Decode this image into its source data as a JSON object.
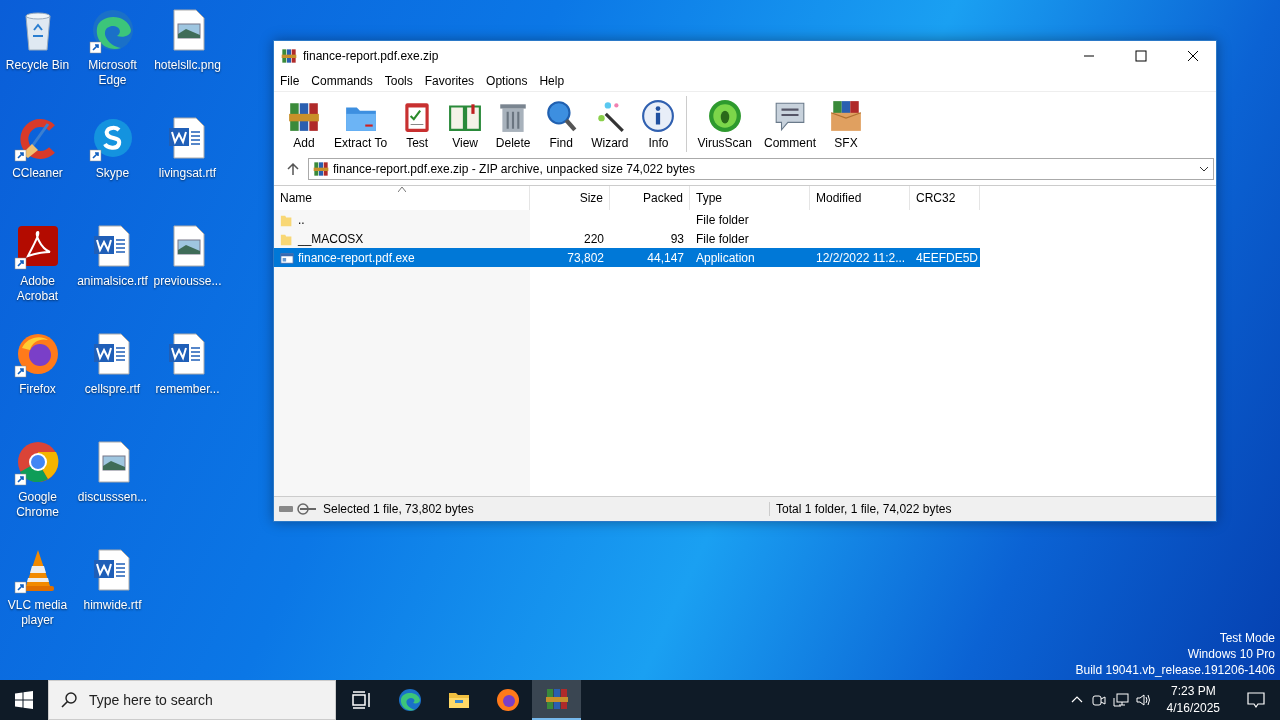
{
  "desktop": {
    "icons": [
      {
        "label": "Recycle Bin",
        "kind": "recycle",
        "shortcut": false
      },
      {
        "label": "CCleaner",
        "kind": "ccleaner",
        "shortcut": true
      },
      {
        "label": "Adobe Acrobat",
        "kind": "pdf",
        "shortcut": true
      },
      {
        "label": "Firefox",
        "kind": "firefox",
        "shortcut": true
      },
      {
        "label": "Google Chrome",
        "kind": "chrome",
        "shortcut": true
      },
      {
        "label": "VLC media player",
        "kind": "vlc",
        "shortcut": true
      },
      {
        "label": "Microsoft Edge",
        "kind": "edge",
        "shortcut": true
      },
      {
        "label": "Skype",
        "kind": "skype",
        "shortcut": true
      },
      {
        "label": "animalsice.rtf",
        "kind": "word",
        "shortcut": false
      },
      {
        "label": "cellspre.rtf",
        "kind": "word",
        "shortcut": false
      },
      {
        "label": "discusssen...",
        "kind": "image",
        "shortcut": false
      },
      {
        "label": "himwide.rtf",
        "kind": "word",
        "shortcut": false
      },
      {
        "label": "hotelsllc.png",
        "kind": "image",
        "shortcut": false
      },
      {
        "label": "livingsat.rtf",
        "kind": "word",
        "shortcut": false
      },
      {
        "label": "previousse...",
        "kind": "image",
        "shortcut": false
      },
      {
        "label": "remember...",
        "kind": "word",
        "shortcut": false
      }
    ],
    "system_text": [
      "Test Mode",
      "Windows 10 Pro",
      "Build 19041.vb_release.191206-1406"
    ]
  },
  "window": {
    "title": "finance-report.pdf.exe.zip",
    "menu": [
      "File",
      "Commands",
      "Tools",
      "Favorites",
      "Options",
      "Help"
    ],
    "toolbar_groups": [
      [
        {
          "label": "Add",
          "kind": "add"
        },
        {
          "label": "Extract To",
          "kind": "extract"
        },
        {
          "label": "Test",
          "kind": "test"
        },
        {
          "label": "View",
          "kind": "view"
        },
        {
          "label": "Delete",
          "kind": "delete"
        },
        {
          "label": "Find",
          "kind": "find"
        },
        {
          "label": "Wizard",
          "kind": "wizard"
        },
        {
          "label": "Info",
          "kind": "info"
        }
      ],
      [
        {
          "label": "VirusScan",
          "kind": "virus"
        },
        {
          "label": "Comment",
          "kind": "comment"
        },
        {
          "label": "SFX",
          "kind": "sfx"
        }
      ]
    ],
    "address": "finance-report.pdf.exe.zip - ZIP archive, unpacked size 74,022 bytes",
    "columns": [
      "Name",
      "Size",
      "Packed",
      "Type",
      "Modified",
      "CRC32"
    ],
    "rows": [
      {
        "kind": "folder",
        "name": "..",
        "size": "",
        "packed": "",
        "type": "File folder",
        "modified": "",
        "crc32": "",
        "selected": false
      },
      {
        "kind": "folder",
        "name": "__MACOSX",
        "size": "220",
        "packed": "93",
        "type": "File folder",
        "modified": "",
        "crc32": "",
        "selected": false
      },
      {
        "kind": "exe",
        "name": "finance-report.pdf.exe",
        "size": "73,802",
        "packed": "44,147",
        "type": "Application",
        "modified": "12/2/2022 11:2...",
        "crc32": "4EEFDE5D",
        "selected": true
      }
    ],
    "status_left": "Selected 1 file, 73,802 bytes",
    "status_right": "Total 1 folder, 1 file, 74,022 bytes"
  },
  "taskbar": {
    "search_placeholder": "Type here to search",
    "apps": [
      {
        "kind": "taskview",
        "active": false
      },
      {
        "kind": "edge",
        "active": false
      },
      {
        "kind": "explorer",
        "active": false
      },
      {
        "kind": "firefox",
        "active": false
      },
      {
        "kind": "winrar",
        "active": true
      }
    ],
    "time": "7:23 PM",
    "date": "4/16/2025"
  }
}
